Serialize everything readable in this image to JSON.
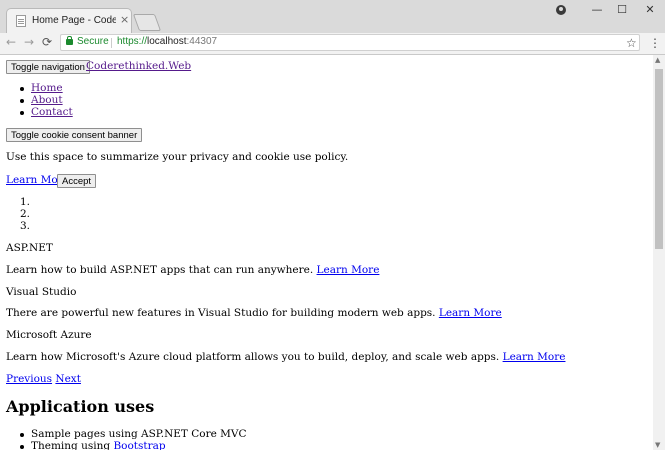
{
  "browser": {
    "tab_title": "Home Page - Coderethinked.Web",
    "tab_close": "×",
    "minimize": "—",
    "maximize": "☐",
    "close": "✕",
    "back": "←",
    "forward": "→",
    "reload": "⟳",
    "secure_label": "Secure",
    "url_scheme": "https://",
    "url_host": "localhost",
    "url_port": ":44307",
    "star": "☆",
    "menu": "⋮"
  },
  "navbar": {
    "toggle_label": "Toggle navigation",
    "brand": "Coderethinked.Web",
    "links": [
      "Home",
      "About",
      "Contact"
    ]
  },
  "cookie": {
    "toggle_label": "Toggle cookie consent banner",
    "text": "Use this space to summarize your privacy and cookie use policy.",
    "learn_more": "Learn More",
    "accept": "Accept"
  },
  "carousel": {
    "indicators": [
      "1.",
      "2.",
      "3."
    ],
    "slides": [
      {
        "img_alt": "ASP.NET",
        "text": "Learn how to build ASP.NET apps that can run anywhere.",
        "link": "Learn More"
      },
      {
        "img_alt": "Visual Studio",
        "text": "There are powerful new features in Visual Studio for building modern web apps.",
        "link": "Learn More"
      },
      {
        "img_alt": "Microsoft Azure",
        "text": "Learn how Microsoft's Azure cloud platform allows you to build, deploy, and scale web apps.",
        "link": "Learn More"
      }
    ],
    "previous": "Previous",
    "next": "Next"
  },
  "app_uses": {
    "heading": "Application uses",
    "items": [
      {
        "text": "Sample pages using ASP.NET Core MVC",
        "link": ""
      },
      {
        "text": "Theming using ",
        "link": "Bootstrap"
      }
    ]
  },
  "colors": {
    "link": "#0000ee",
    "visited": "#551a8b",
    "secure": "#1b8a2e"
  }
}
